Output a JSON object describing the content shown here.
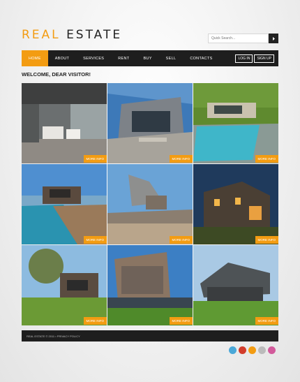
{
  "logo": {
    "word1": "REAL",
    "word2": "ESTATE"
  },
  "search": {
    "placeholder": "Quick Search..."
  },
  "nav": {
    "items": [
      "HOME",
      "ABOUT",
      "SERVICES",
      "RENT",
      "BUY",
      "SELL",
      "CONTACTS"
    ],
    "active": "HOME",
    "login": "LOG IN",
    "signup": "SIGN UP"
  },
  "welcome": "WELCOME, DEAR VISITOR!",
  "gallery": {
    "more_label": "MORE INFO"
  },
  "footer": {
    "text": "REAL ESTATE © 2011 • PRIVACY POLICY"
  },
  "social": [
    "twitter-icon",
    "youtube-icon",
    "rss-icon",
    "delicious-icon",
    "flickr-icon"
  ],
  "colors": {
    "accent": "#f39c12",
    "dark": "#1e1e1e"
  }
}
